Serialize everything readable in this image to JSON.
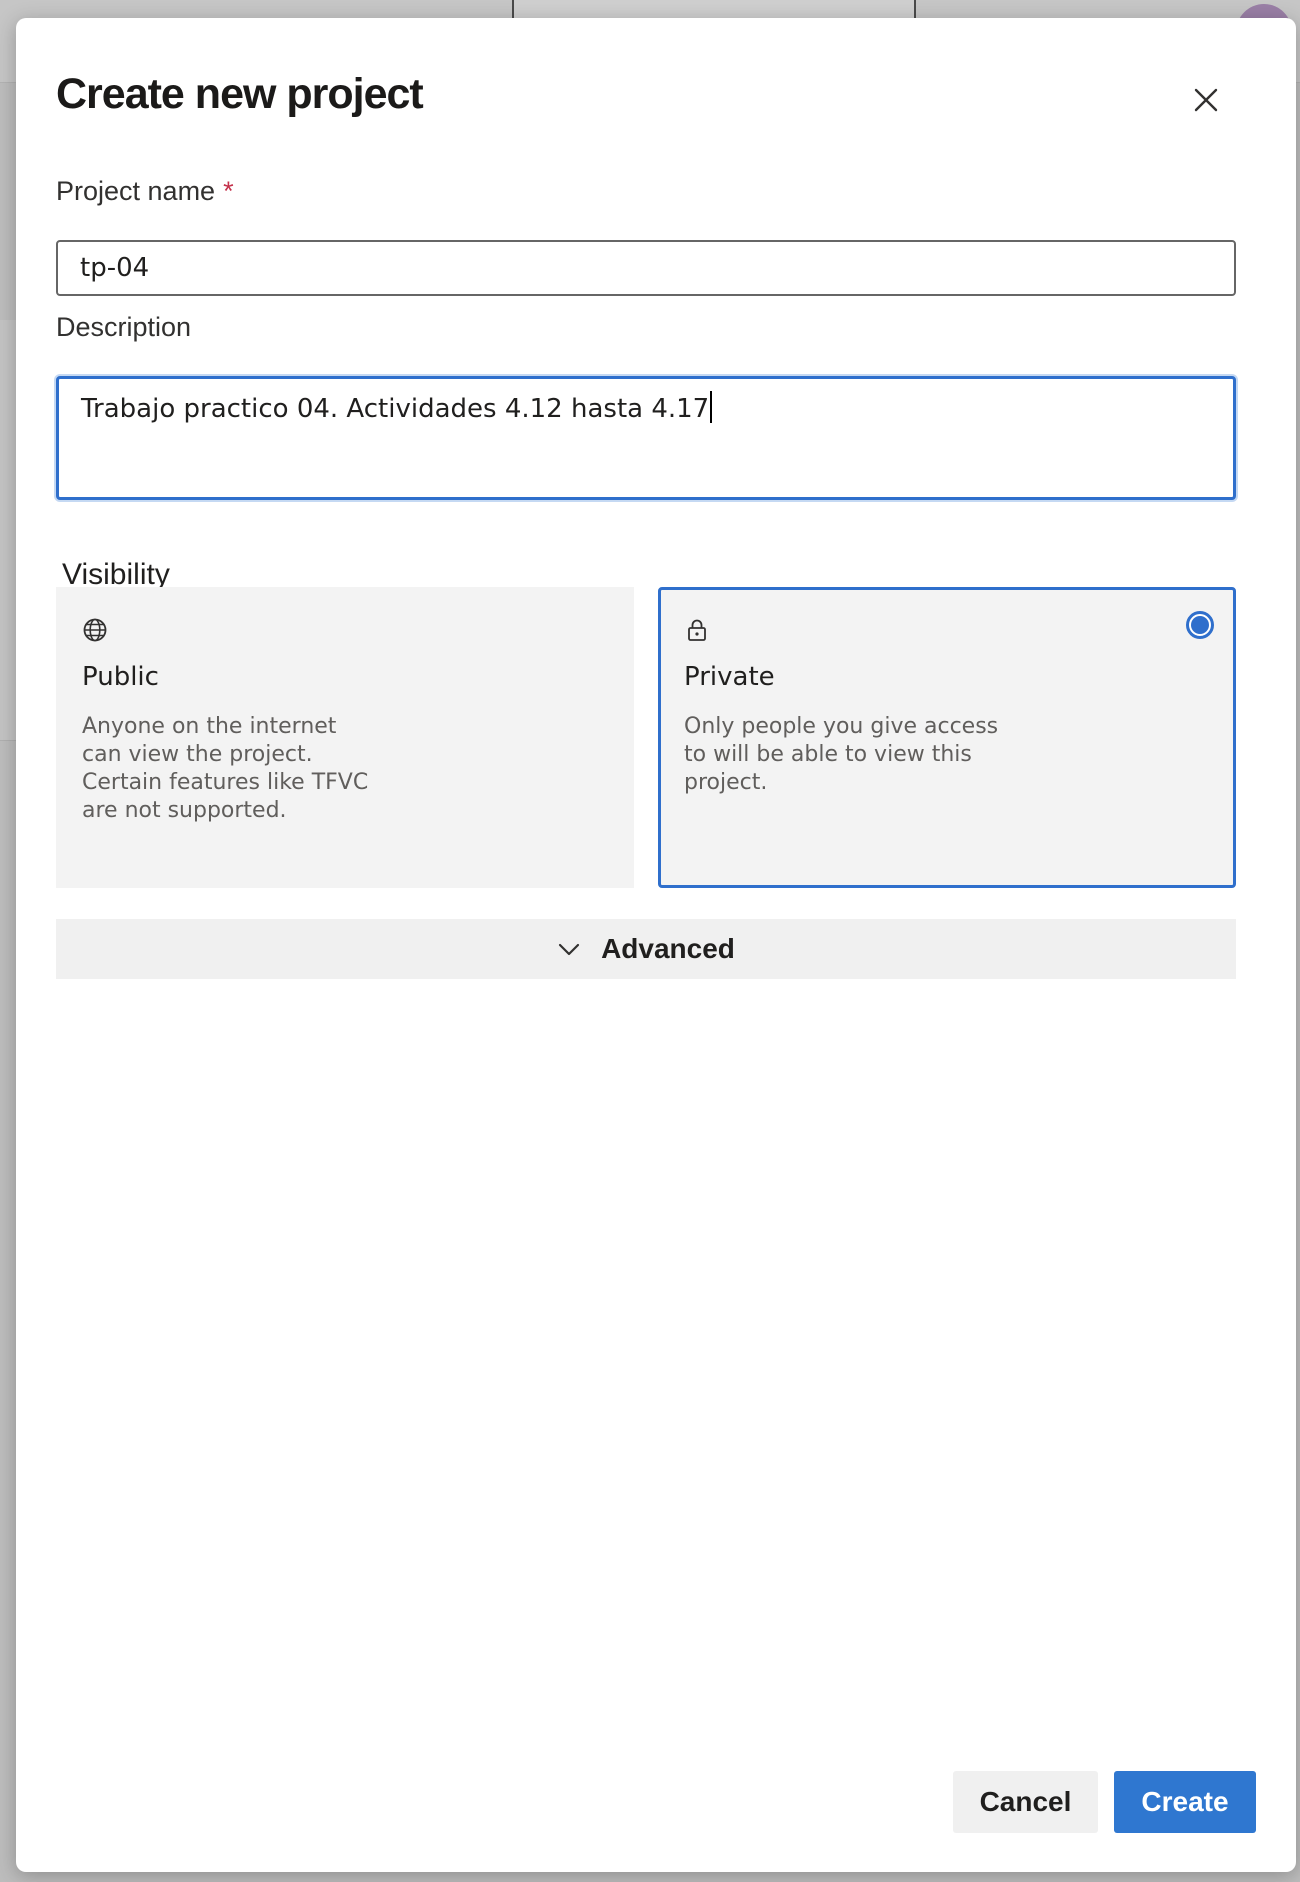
{
  "dialog": {
    "title": "Create new project",
    "close_icon": "close-icon"
  },
  "form": {
    "project_name_label": "Project name",
    "required_marker": "*",
    "project_name_value": "tp-04",
    "description_label": "Description",
    "description_value": "Trabajo practico 04. Actividades 4.12 hasta 4.17"
  },
  "visibility": {
    "label": "Visibility",
    "selected": "Private",
    "options": [
      {
        "icon": "globe-icon",
        "title": "Public",
        "description": "Anyone on the internet can view the project. Certain features like TFVC are not supported."
      },
      {
        "icon": "lock-icon",
        "title": "Private",
        "description": "Only people you give access to will be able to view this project."
      }
    ]
  },
  "advanced": {
    "icon": "chevron-down-icon",
    "label": "Advanced"
  },
  "footer": {
    "cancel_label": "Cancel",
    "create_label": "Create"
  },
  "colors": {
    "accent": "#2f77d0",
    "required": "#c4314b"
  }
}
